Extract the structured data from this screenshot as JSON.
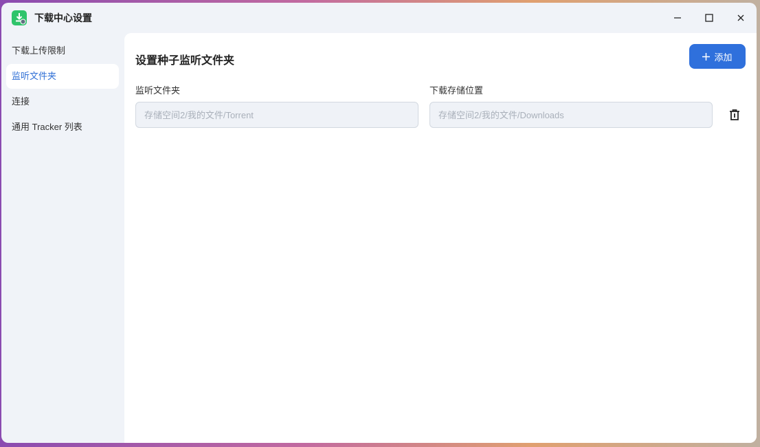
{
  "window": {
    "title": "下载中心设置"
  },
  "sidebar": {
    "items": [
      {
        "label": "下载上传限制"
      },
      {
        "label": "监听文件夹"
      },
      {
        "label": "连接"
      },
      {
        "label": "通用 Tracker 列表"
      }
    ]
  },
  "main": {
    "title": "设置种子监听文件夹",
    "add_label": "添加",
    "columns": {
      "watch": "监听文件夹",
      "save": "下载存储位置"
    },
    "row": {
      "watch_placeholder": "存储空间2/我的文件/Torrent",
      "save_placeholder": "存储空间2/我的文件/Downloads"
    }
  },
  "colors": {
    "accent": "#2f70dc",
    "app_icon": "#2fc46b"
  }
}
